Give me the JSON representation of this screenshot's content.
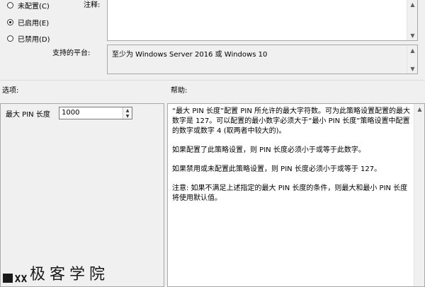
{
  "state_options": [
    {
      "label": "未配置(C)",
      "selected": false
    },
    {
      "label": "已启用(E)",
      "selected": true
    },
    {
      "label": "已禁用(D)",
      "selected": false
    }
  ],
  "comment": {
    "label": "注释:",
    "value": ""
  },
  "supported": {
    "label": "支持的平台:",
    "value": "至少为 Windows Server 2016 或 Windows 10"
  },
  "options": {
    "label": "选项:",
    "field_label": "最大 PIN 长度",
    "field_value": "1000"
  },
  "help": {
    "label": "帮助:",
    "paragraphs": [
      "“最大 PIN 长度”配置 PIN 所允许的最大字符数。可为此策略设置配置的最大数字是 127。可以配置的最小数字必须大于“最小 PIN 长度”策略设置中配置的数字或数字 4 (取两者中较大的)。",
      "如果配置了此策略设置，则 PIN 长度必须小于或等于此数字。",
      "如果禁用或未配置此策略设置，则 PIN 长度必须小于或等于 127。",
      "注意: 如果不满足上述指定的最大 PIN 长度的条件，则最大和最小 PIN 长度将使用默认值。"
    ]
  },
  "watermark": {
    "text": "极客学院"
  }
}
